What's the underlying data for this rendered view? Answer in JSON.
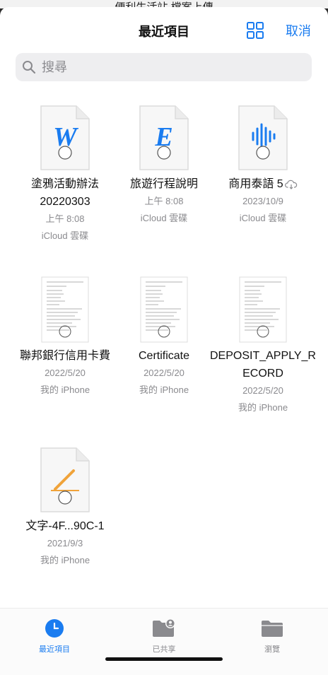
{
  "header": {
    "peek_title": "便利生活站 檔案上傳",
    "title": "最近項目",
    "cancel_label": "取消"
  },
  "search": {
    "placeholder": "搜尋"
  },
  "files": [
    {
      "name": "塗鴉活動辦法20220303",
      "meta1": "上午 8:08",
      "meta2": "iCloud 雲碟",
      "icon": "word-document-icon"
    },
    {
      "name": "旅遊行程說明",
      "meta1": "上午 8:08",
      "meta2": "iCloud 雲碟",
      "icon": "excel-document-icon"
    },
    {
      "name": "商用泰語 5",
      "meta1": "2023/10/9",
      "meta2": "iCloud 雲碟",
      "icon": "audio-document-icon",
      "cloud": true
    },
    {
      "name": "聯邦銀行信用卡費",
      "meta1": "2022/5/20",
      "meta2": "我的 iPhone",
      "icon": "pdf-page-thumbnail"
    },
    {
      "name": "Certificate",
      "meta1": "2022/5/20",
      "meta2": "我的 iPhone",
      "icon": "pdf-page-thumbnail"
    },
    {
      "name": "DEPOSIT_APPLY_RECORD",
      "meta1": "2022/5/20",
      "meta2": "我的 iPhone",
      "icon": "pdf-page-thumbnail"
    },
    {
      "name": "文字-4F...90C-1",
      "meta1": "2021/9/3",
      "meta2": "我的 iPhone",
      "icon": "pages-document-icon"
    }
  ],
  "tabs": [
    {
      "label": "最近項目",
      "icon": "clock-icon",
      "active": true
    },
    {
      "label": "已共享",
      "icon": "shared-folder-icon",
      "active": false
    },
    {
      "label": "瀏覽",
      "icon": "folder-icon",
      "active": false
    }
  ],
  "colors": {
    "accent": "#1a7cf0",
    "inactive": "#8a8a8e",
    "pages_orange": "#f0a33a"
  }
}
